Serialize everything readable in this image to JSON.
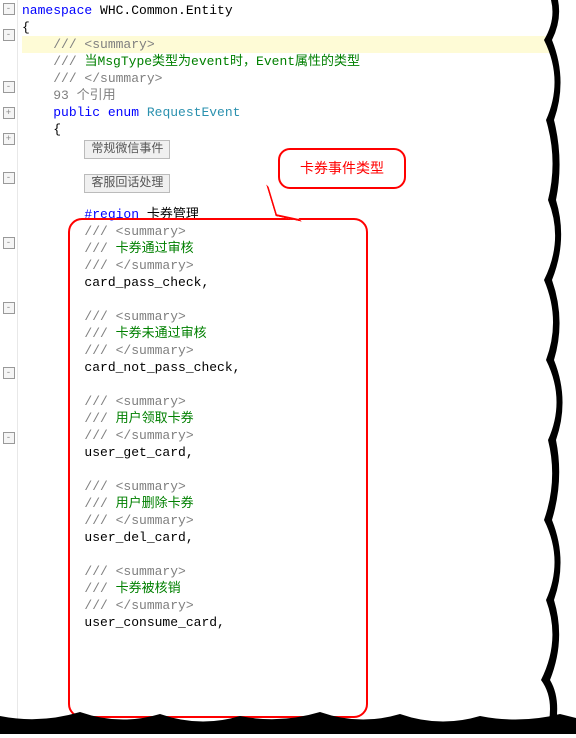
{
  "namespace_kw": "namespace",
  "namespace_name": " WHC.Common.Entity",
  "brace_open": "{",
  "brace_close": "}",
  "summary_open": "/// <summary>",
  "summary_close": "/// </summary>",
  "comment_prefix": "/// ",
  "enum_comment": "当MsgType类型为event时，Event属性的类型",
  "refs_text": "93 个引用",
  "public_kw": "public",
  "enum_kw": " enum ",
  "enum_name": "RequestEvent",
  "region1": "常规微信事件",
  "region2": "客服回话处理",
  "region_kw": "#region",
  "region_card": " 卡券管理",
  "callout_text": "卡券事件类型",
  "items": [
    {
      "desc": "卡券通过审核",
      "name": "card_pass_check,"
    },
    {
      "desc": "卡券未通过审核",
      "name": "card_not_pass_check,"
    },
    {
      "desc": "用户领取卡券",
      "name": "user_get_card,"
    },
    {
      "desc": "用户删除卡券",
      "name": "user_del_card,"
    },
    {
      "desc": "卡券被核销",
      "name": "user_consume_card,"
    }
  ]
}
